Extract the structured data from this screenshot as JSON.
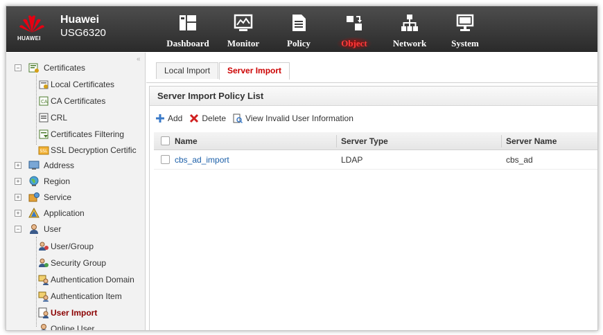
{
  "header": {
    "logo_text": "HUAWEI",
    "brand": "Huawei",
    "model": "USG6320",
    "nav": [
      {
        "label": "Dashboard",
        "icon": "dashboard-icon"
      },
      {
        "label": "Monitor",
        "icon": "monitor-icon"
      },
      {
        "label": "Policy",
        "icon": "policy-icon"
      },
      {
        "label": "Object",
        "icon": "object-icon",
        "active": true
      },
      {
        "label": "Network",
        "icon": "network-icon"
      },
      {
        "label": "System",
        "icon": "system-icon"
      }
    ]
  },
  "sidebar": {
    "collapse_glyph": "«",
    "items": [
      {
        "label": "Certificates",
        "icon": "certificate-icon",
        "expander": "−"
      },
      {
        "label": "Local Certificates",
        "icon": "local-certificate-icon"
      },
      {
        "label": "CA Certificates",
        "icon": "ca-certificate-icon"
      },
      {
        "label": "CRL",
        "icon": "crl-icon"
      },
      {
        "label": "Certificates Filtering",
        "icon": "certificate-filter-icon"
      },
      {
        "label": "SSL Decryption Certific",
        "icon": "ssl-certificate-icon"
      },
      {
        "label": "Address",
        "icon": "address-icon",
        "expander": "+"
      },
      {
        "label": "Region",
        "icon": "region-globe-icon",
        "expander": "+"
      },
      {
        "label": "Service",
        "icon": "service-icon",
        "expander": "+"
      },
      {
        "label": "Application",
        "icon": "application-icon",
        "expander": "+"
      },
      {
        "label": "User",
        "icon": "user-icon",
        "expander": "−"
      },
      {
        "label": "User/Group",
        "icon": "user-group-icon"
      },
      {
        "label": "Security Group",
        "icon": "security-group-icon"
      },
      {
        "label": "Authentication Domain",
        "icon": "authentication-domain-icon"
      },
      {
        "label": "Authentication Item",
        "icon": "authentication-item-icon"
      },
      {
        "label": "User Import",
        "icon": "user-import-icon",
        "selected": true
      },
      {
        "label": "Online User",
        "icon": "online-user-icon"
      }
    ]
  },
  "main": {
    "tabs": [
      {
        "label": "Local Import"
      },
      {
        "label": "Server Import",
        "active": true
      }
    ],
    "panel_title": "Server Import Policy List",
    "toolbar": {
      "add": "Add",
      "delete": "Delete",
      "view_invalid": "View Invalid User Information"
    },
    "table": {
      "columns": [
        "Name",
        "Server Type",
        "Server Name"
      ],
      "rows": [
        {
          "name": "cbs_ad_import",
          "server_type": "LDAP",
          "server_name": "cbs_ad"
        }
      ]
    }
  },
  "colors": {
    "header_bg": "#3a3a3a",
    "active_nav": "#ff3b3b",
    "link": "#1a5ea8",
    "selected_tree": "#8b0000"
  }
}
